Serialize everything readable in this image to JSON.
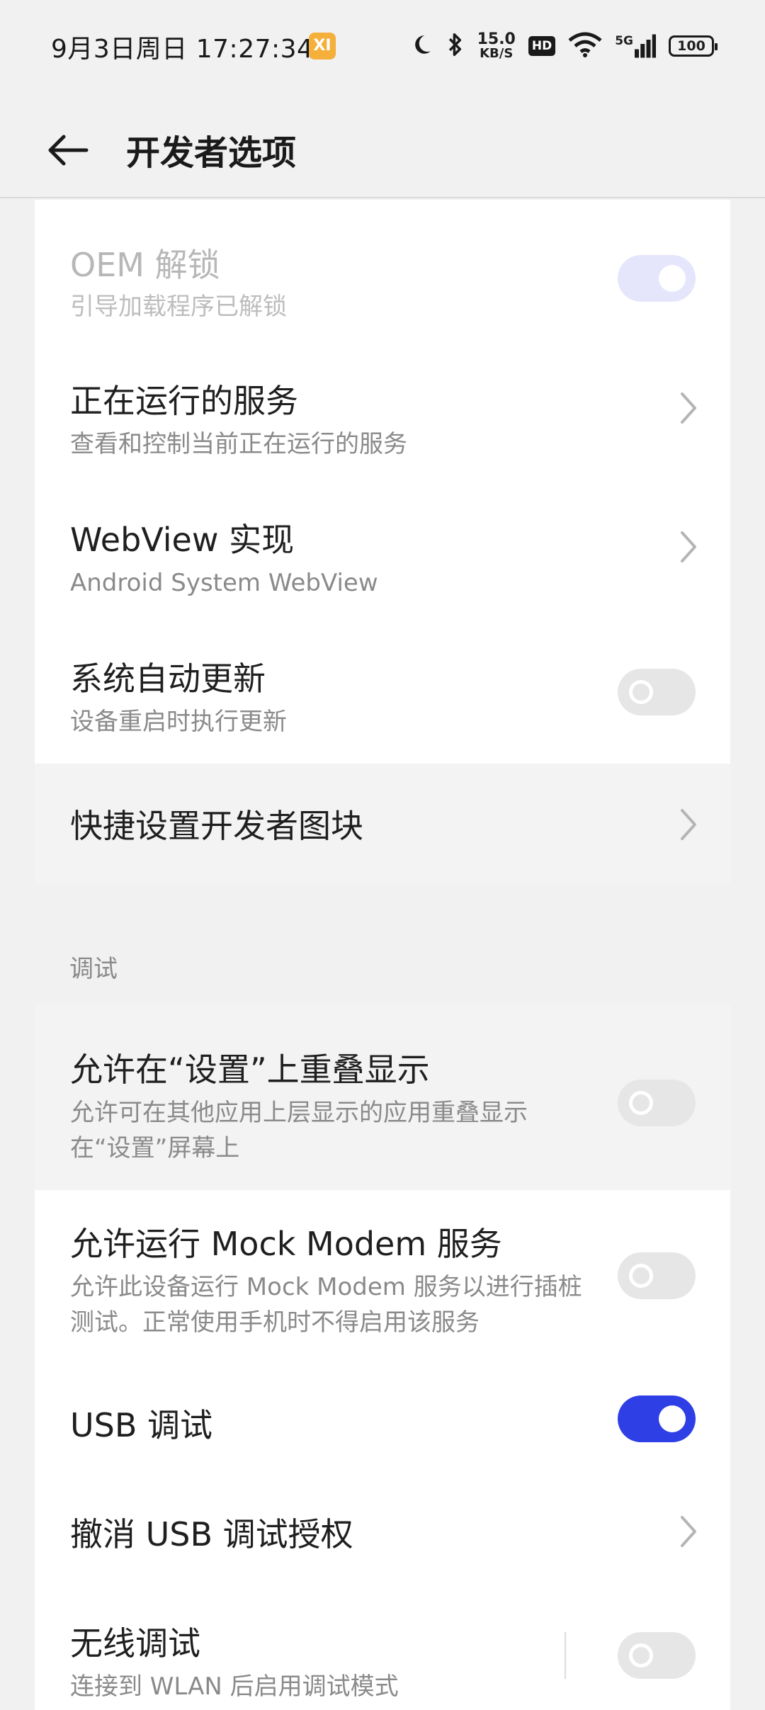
{
  "status_bar": {
    "time": "9月3日周日 17:27:34",
    "badge": "XI",
    "net_speed_value": "15.0",
    "net_speed_unit": "KB/S",
    "hd": "HD",
    "signal": "5G",
    "battery": "100",
    "icons": [
      "moon-icon",
      "bluetooth-icon",
      "wifi-icon",
      "signal-icon"
    ]
  },
  "header": {
    "title": "开发者选项",
    "back_icon": "arrow-left-icon"
  },
  "rows": {
    "oem_unlock": {
      "title": "OEM 解锁",
      "subtitle": "引导加载程序已解锁",
      "state": "on-disabled"
    },
    "running_services": {
      "title": "正在运行的服务",
      "subtitle": "查看和控制当前正在运行的服务"
    },
    "webview": {
      "title": "WebView 实现",
      "subtitle": "Android System WebView"
    },
    "auto_update": {
      "title": "系统自动更新",
      "subtitle": "设备重启时执行更新",
      "state": "off"
    },
    "quick_tiles": {
      "title": "快捷设置开发者图块"
    },
    "overlay": {
      "title": "允许在“设置”上重叠显示",
      "subtitle": "允许可在其他应用上层显示的应用重叠显示在“设置”屏幕上",
      "state": "off"
    },
    "mock_modem": {
      "title": "允许运行 Mock Modem 服务",
      "subtitle": "允许此设备运行 Mock Modem 服务以进行插桩测试。正常使用手机时不得启用该服务",
      "state": "off"
    },
    "usb_debug": {
      "title": "USB 调试",
      "state": "on"
    },
    "revoke_usb": {
      "title": "撤消 USB 调试授权"
    },
    "wireless_debug": {
      "title": "无线调试",
      "subtitle": "连接到 WLAN 后启用调试模式",
      "state": "off"
    }
  },
  "sections": {
    "debug": "调试"
  },
  "colors": {
    "accent": "#2f3fe6",
    "background": "#f1f1f1",
    "card": "#ffffff"
  }
}
